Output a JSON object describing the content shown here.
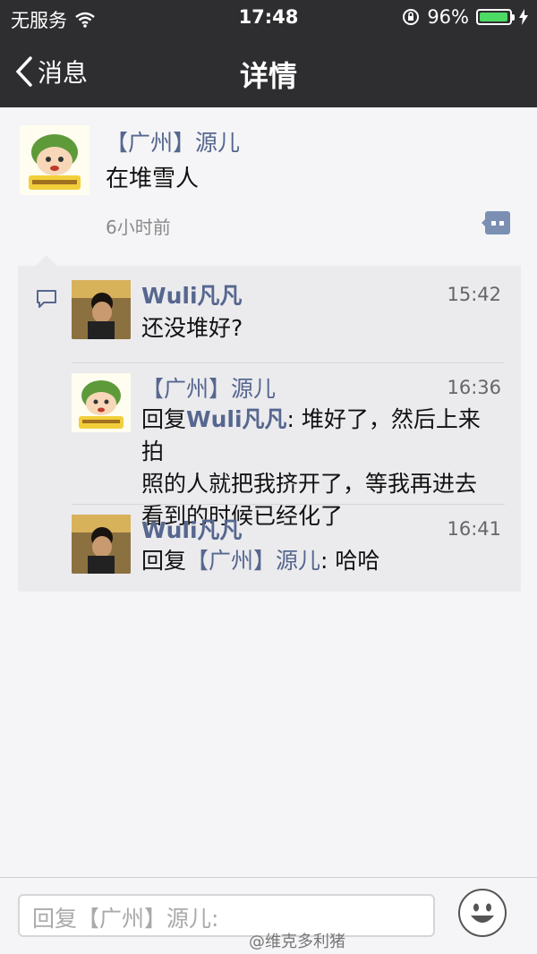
{
  "status_bar": {
    "carrier": "无服务",
    "time": "17:48",
    "battery_percent": "96%",
    "battery_level": 0.96
  },
  "nav": {
    "back_label": "消息",
    "title": "详情"
  },
  "post": {
    "author": "【广州】源儿",
    "text": "在堆雪人",
    "time_ago": "6小时前"
  },
  "comments": [
    {
      "author": "Wuli凡凡",
      "time": "15:42",
      "text": "还没堆好?"
    },
    {
      "author": "【广州】源儿",
      "time": "16:36",
      "reply_prefix": "回复",
      "reply_to": "Wuli凡凡",
      "text_first": ": 堆好了，然后上来拍",
      "text_rest": [
        "照的人就把我挤开了，等我再进去",
        "看到的时候已经化了"
      ]
    },
    {
      "author": "Wuli凡凡",
      "time": "16:41",
      "reply_prefix": "回复",
      "reply_to": "【广州】源儿",
      "text_first": ": 哈哈"
    }
  ],
  "reply_input": {
    "placeholder": "回复【广州】源儿:"
  },
  "watermark": "@维克多利猪",
  "colors": {
    "bar_bg": "#2e2e30",
    "name_blue": "#56678f",
    "battery_green": "#4cd964"
  }
}
